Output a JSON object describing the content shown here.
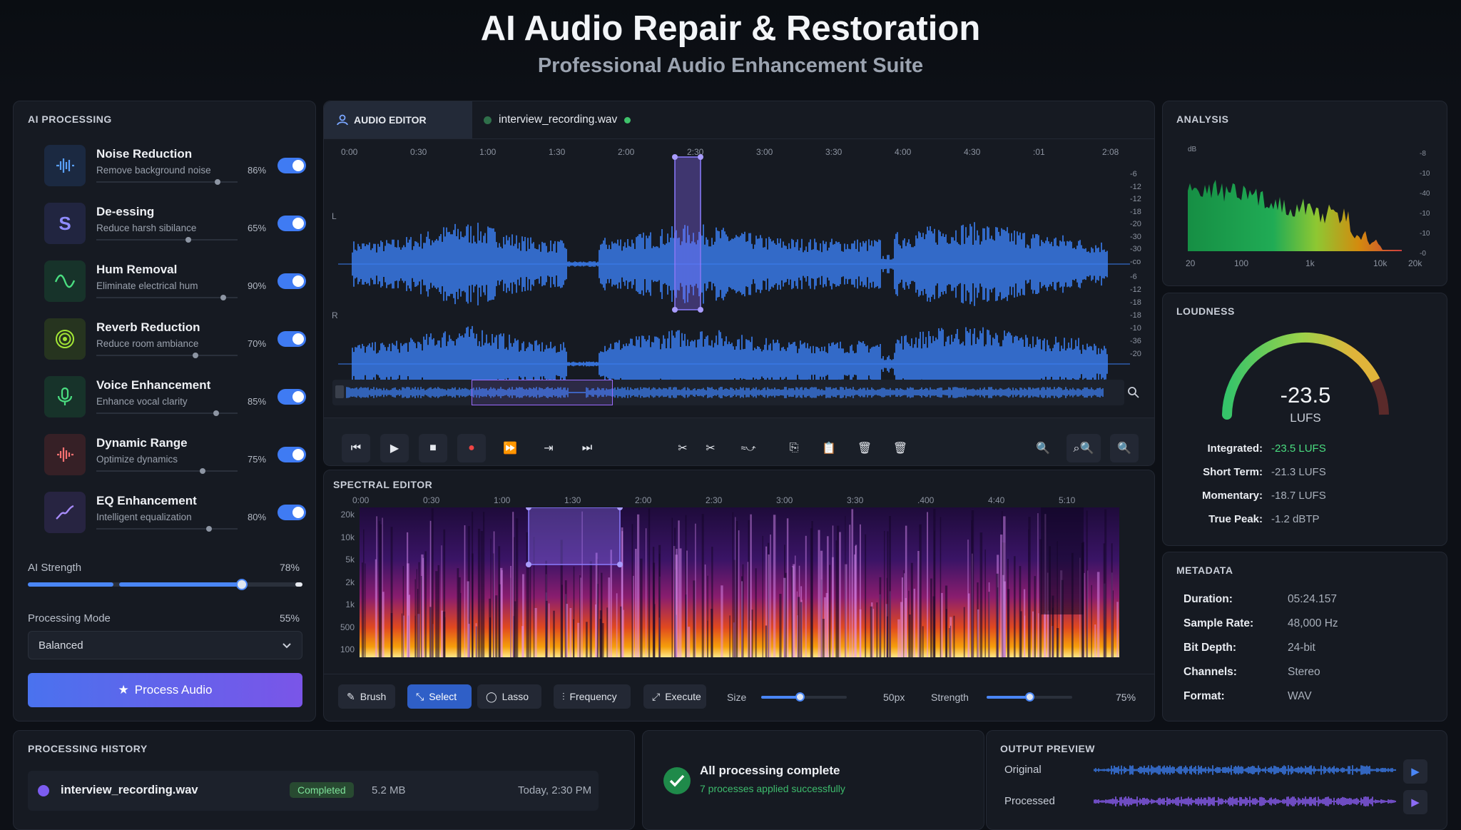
{
  "header": {
    "title": "AI Audio Repair & Restoration",
    "subtitle": "Professional Audio Enhancement Suite"
  },
  "ai_processing": {
    "title": "AI PROCESSING",
    "modules": [
      {
        "name": "Noise Reduction",
        "desc": "Remove background noise",
        "pct": "86%",
        "level": 0.86,
        "icon": "noise-waveform-icon",
        "color": "#3b82f6"
      },
      {
        "name": "De-essing",
        "desc": "Reduce harsh sibilance",
        "pct": "65%",
        "level": 0.65,
        "icon": "s-letter-icon",
        "color": "#6366f1"
      },
      {
        "name": "Hum Removal",
        "desc": "Eliminate electrical hum",
        "pct": "90%",
        "level": 0.9,
        "icon": "sine-wave-icon",
        "color": "#22c55e"
      },
      {
        "name": "Reverb Reduction",
        "desc": "Reduce room ambiance",
        "pct": "70%",
        "level": 0.7,
        "icon": "concentric-circles-icon",
        "color": "#84cc16"
      },
      {
        "name": "Voice Enhancement",
        "desc": "Enhance vocal clarity",
        "pct": "85%",
        "level": 0.85,
        "icon": "microphone-icon",
        "color": "#22c55e"
      },
      {
        "name": "Dynamic Range",
        "desc": "Optimize dynamics",
        "pct": "75%",
        "level": 0.75,
        "icon": "dynamics-bars-icon",
        "color": "#ef4444"
      },
      {
        "name": "EQ Enhancement",
        "desc": "Intelligent equalization",
        "pct": "80%",
        "level": 0.8,
        "icon": "eq-curve-icon",
        "color": "#8b5cf6"
      }
    ],
    "strength_label": "AI Strength",
    "strength_value": "78%",
    "strength_level": 0.78,
    "mode_label": "Processing Mode",
    "mode_value": "55%",
    "mode_selected": "Balanced",
    "process_button": "Process Audio"
  },
  "editor": {
    "tab_label": "AUDIO EDITOR",
    "file_name": "interview_recording.wav",
    "time_ticks": [
      "0:00",
      "0:30",
      "1:00",
      "1:30",
      "2:00",
      "2:30",
      "3:00",
      "3:30",
      "4:00",
      "4:30",
      ":01",
      "2:08"
    ],
    "channels": [
      "L",
      "R"
    ],
    "db_ticks_l": [
      "-6",
      "-12",
      "-12",
      "-18",
      "-20",
      "-30",
      "-30",
      "-co"
    ],
    "db_ticks_r": [
      "-6",
      "-12",
      "-18",
      "-18",
      "-10",
      "-36",
      "-20"
    ]
  },
  "spectral": {
    "title": "SPECTRAL EDITOR",
    "time_ticks": [
      "0:00",
      "0:30",
      "1:00",
      "1:30",
      "2:00",
      "2:30",
      "3:00",
      "3:30",
      ".400",
      "4:40",
      "5:10"
    ],
    "freq_ticks": [
      "20k",
      "10k",
      "5k",
      "2k",
      "1k",
      "500",
      "100"
    ],
    "tools": [
      "Brush",
      "Select",
      "Lasso",
      "Frequency",
      "Execute"
    ],
    "active_tool": "Select",
    "size_label": "Size",
    "size_value": "50px",
    "size_level": 0.45,
    "strength_label": "Strength",
    "strength_value": "75%",
    "strength_level": 0.5
  },
  "analysis": {
    "title": "ANALYSIS",
    "x_ticks": [
      "20",
      "100",
      "1k",
      "10k",
      "20k"
    ],
    "y_ticks": [
      "-8",
      "-10",
      "-40",
      "-10",
      "-10",
      "-0"
    ]
  },
  "loudness": {
    "title": "LOUDNESS",
    "value": "-23.5",
    "unit": "LUFS",
    "rows": [
      {
        "k": "Integrated:",
        "v": "-23.5 LUFS"
      },
      {
        "k": "Short Term:",
        "v": "-21.3 LUFS"
      },
      {
        "k": "Momentary:",
        "v": "-18.7 LUFS"
      },
      {
        "k": "True Peak:",
        "v": "-1.2 dBTP"
      }
    ]
  },
  "metadata": {
    "title": "METADATA",
    "rows": [
      {
        "k": "Duration:",
        "v": "05:24.157"
      },
      {
        "k": "Sample Rate:",
        "v": "48,000 Hz"
      },
      {
        "k": "Bit Depth:",
        "v": "24-bit"
      },
      {
        "k": "Channels:",
        "v": "Stereo"
      },
      {
        "k": "Format:",
        "v": "WAV"
      }
    ]
  },
  "history": {
    "title": "PROCESSING HISTORY",
    "file": "interview_recording.wav",
    "status": "Completed",
    "size": "5.2 MB",
    "time": "Today, 2:30 PM"
  },
  "status": {
    "title": "All processing complete",
    "sub": "7 processes applied successfully"
  },
  "output": {
    "title": "OUTPUT PREVIEW",
    "original": "Original",
    "processed": "Processed"
  }
}
